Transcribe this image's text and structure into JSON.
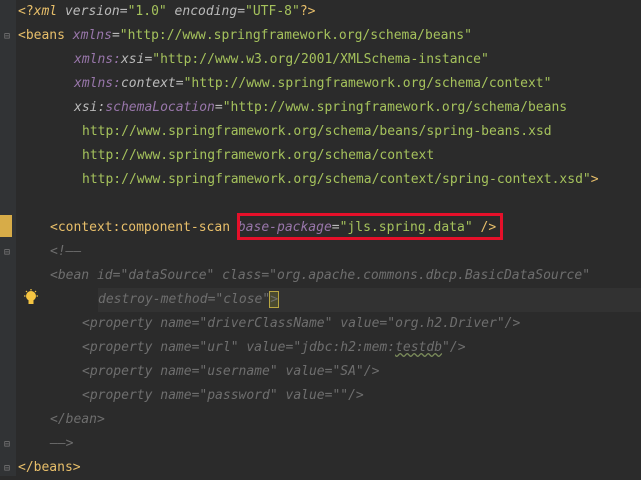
{
  "lines": {
    "l1": {
      "a": "<?",
      "b": "xml",
      "c": " version",
      "d": "=",
      "e": "\"1.0\"",
      "f": " encoding",
      "g": "=",
      "h": "\"UTF-8\"",
      "i": "?>"
    },
    "l2": {
      "a": "<beans ",
      "b": "xmlns",
      "c": "=",
      "d": "\"http://www.springframework.org/schema/beans\""
    },
    "l3": {
      "a": "xmlns:",
      "b": "xsi",
      "c": "=",
      "d": "\"http://www.w3.org/2001/XMLSchema-instance\""
    },
    "l4": {
      "a": "xmlns:",
      "b": "context",
      "c": "=",
      "d": "\"http://www.springframework.org/schema/context\""
    },
    "l5": {
      "a": "xsi:",
      "b": "schemaLocation",
      "c": "=",
      "d": "\"http://www.springframework.org/schema/beans"
    },
    "l6": {
      "a": "http://www.springframework.org/schema/beans/spring-beans.xsd"
    },
    "l7": {
      "a": "http://www.springframework.org/schema/context"
    },
    "l8": {
      "a": "http://www.springframework.org/schema/context/spring-context.xsd\"",
      "b": ">"
    },
    "l10": {
      "a": "<context",
      "b": ":component-scan ",
      "c": "base-package",
      "d": "=",
      "e": "\"jls.spring.data\"",
      "f": " />"
    },
    "l11": {
      "a": "<!——"
    },
    "l12": {
      "a": "<bean id=\"dataSource\" class=\"org.apache.commons.dbcp.BasicDataSource\""
    },
    "l13": {
      "a": "destroy-method=\"close\"",
      "b": ">"
    },
    "l14": {
      "a": "<property name=\"driverClassName\" value=\"org.h2.Driver\"/>"
    },
    "l15": {
      "a": "<property name=\"url\" value=\"jdbc:h2:mem:",
      "b": "testdb",
      "c": "\"/>"
    },
    "l16": {
      "a": "<property name=\"username\" value=\"SA\"/>"
    },
    "l17": {
      "a": "<property name=\"password\" value=\"\"/>"
    },
    "l18": {
      "a": "</bean>"
    },
    "l19": {
      "a": "——>"
    },
    "l20": {
      "a": "</beans>"
    }
  },
  "colors": {
    "background": "#2b2b2b",
    "tag": "#e8bf6a",
    "string": "#6a8759",
    "comment": "#6e6e6e",
    "highlight_box": "#e5102a"
  }
}
